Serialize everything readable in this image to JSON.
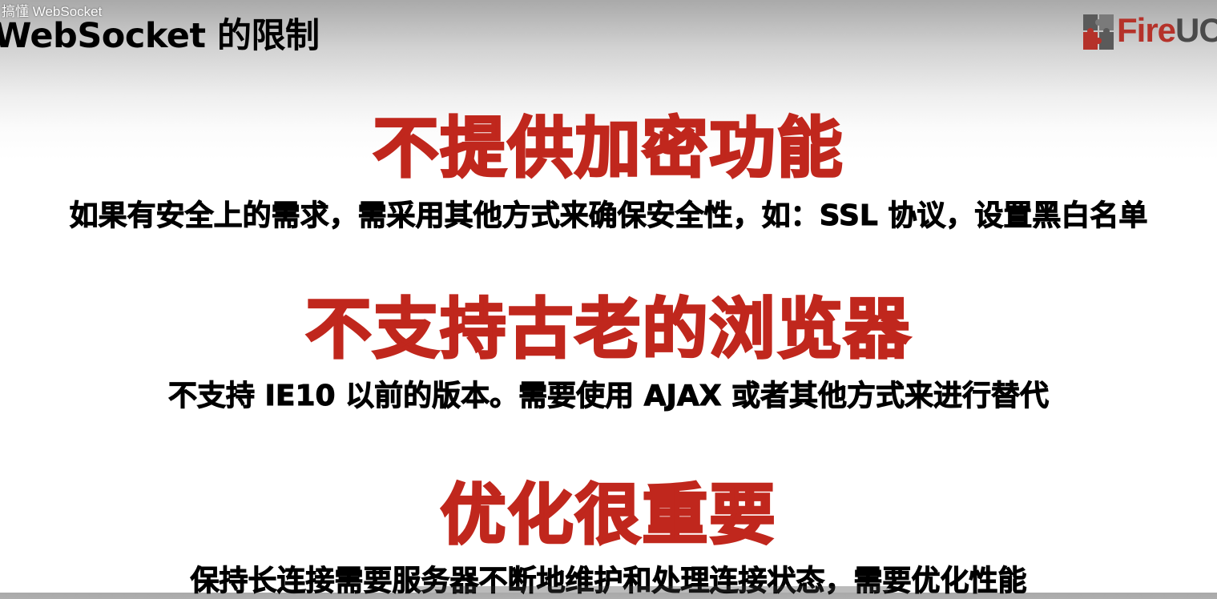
{
  "video": {
    "title": "搞懂 WebSocket"
  },
  "slide": {
    "title": "WebSocket 的限制",
    "logo": {
      "text_fire": "Fire",
      "text_uc": "UC",
      "brand_color": "#b5322a",
      "accent_color": "#4a4a4a"
    },
    "sections": [
      {
        "heading": "不提供加密功能",
        "detail": "如果有安全上的需求，需采用其他方式来确保安全性，如：SSL 协议，设置黑白名单"
      },
      {
        "heading": "不支持古老的浏览器",
        "detail": "不支持 IE10 以前的版本。需要使用 AJAX 或者其他方式来进行替代"
      },
      {
        "heading": "优化很重要",
        "detail": "保持长连接需要服务器不断地维护和处理连接状态，需要优化性能"
      }
    ],
    "heading_color": "#c0271d",
    "detail_color": "#000000"
  }
}
